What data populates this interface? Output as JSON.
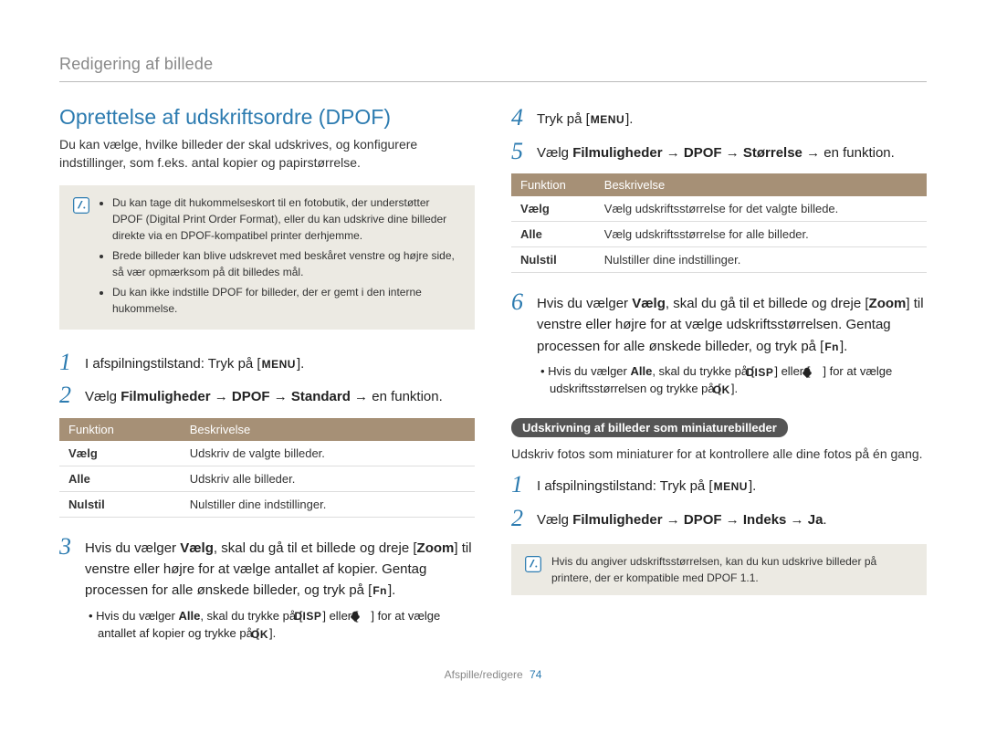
{
  "breadcrumb": "Redigering af billede",
  "left": {
    "heading": "Oprettelse af udskriftsordre (DPOF)",
    "intro": "Du kan vælge, hvilke billeder der skal udskrives, og konfigurere indstillinger, som f.eks. antal kopier og papirstørrelse.",
    "note_items": [
      "Du kan tage dit hukommelseskort til en fotobutik, der understøtter DPOF (Digital Print Order Format), eller du kan udskrive dine billeder direkte via en DPOF-kompatibel printer derhjemme.",
      "Brede billeder kan blive udskrevet med beskåret venstre og højre side, så vær opmærksom på dit billedes mål.",
      "Du kan ikke indstille DPOF for billeder, der er gemt i den interne hukommelse."
    ],
    "step1_a": "I afspilningstilstand: Tryk på [",
    "step1_b": "].",
    "step2_a": "Vælg ",
    "step2_b": " → en funktion.",
    "step2_path": "Filmuligheder → DPOF → Standard",
    "table_hdr_func": "Funktion",
    "table_hdr_desc": "Beskrivelse",
    "table_rows": [
      {
        "f": "Vælg",
        "d": "Udskriv de valgte billeder."
      },
      {
        "f": "Alle",
        "d": "Udskriv alle billeder."
      },
      {
        "f": "Nulstil",
        "d": "Nulstiller dine indstillinger."
      }
    ],
    "step3_a": "Hvis du vælger ",
    "step3_bold1": "Vælg",
    "step3_b": ", skal du gå til et billede og dreje [",
    "step3_bold2": "Zoom",
    "step3_c": "] til venstre eller højre for at vælge antallet af kopier. Gentag processen for alle ønskede billeder, og tryk på [",
    "step3_d": "].",
    "step3_sub_a": "• Hvis du vælger ",
    "step3_sub_bold": "Alle",
    "step3_sub_b": ", skal du trykke på [",
    "step3_sub_c": "] eller [",
    "step3_sub_d": "] for at vælge antallet af kopier og trykke på [",
    "step3_sub_e": "]."
  },
  "right": {
    "step4_a": "Tryk på [",
    "step4_b": "].",
    "step5_a": "Vælg ",
    "step5_path": "Filmuligheder → DPOF → Størrelse",
    "step5_b": " → en funktion.",
    "table_hdr_func": "Funktion",
    "table_hdr_desc": "Beskrivelse",
    "table_rows": [
      {
        "f": "Vælg",
        "d": "Vælg udskriftsstørrelse for det valgte billede."
      },
      {
        "f": "Alle",
        "d": "Vælg udskriftsstørrelse for alle billeder."
      },
      {
        "f": "Nulstil",
        "d": "Nulstiller dine indstillinger."
      }
    ],
    "step6_a": "Hvis du vælger ",
    "step6_bold1": "Vælg",
    "step6_b": ", skal du gå til et billede og dreje [",
    "step6_bold2": "Zoom",
    "step6_c": "] til venstre eller højre for at vælge udskriftsstørrelsen. Gentag processen for alle ønskede billeder, og tryk på [",
    "step6_d": "].",
    "step6_sub_a": "• Hvis du vælger ",
    "step6_sub_bold": "Alle",
    "step6_sub_b": ", skal du trykke på [",
    "step6_sub_c": "] eller [",
    "step6_sub_d": "] for at vælge udskriftsstørrelsen og trykke på [",
    "step6_sub_e": "].",
    "pill": "Udskrivning af billeder som miniaturebilleder",
    "pill_para": "Udskriv fotos som miniaturer for at kontrollere alle dine fotos på én gang.",
    "r_step1_a": "I afspilningstilstand: Tryk på [",
    "r_step1_b": "].",
    "r_step2_a": "Vælg ",
    "r_step2_path": "Filmuligheder → DPOF → Indeks → Ja",
    "r_step2_b": ".",
    "note2": "Hvis du angiver udskriftsstørrelsen, kan du kun udskrive billeder på printere, der er kompatible med DPOF 1.1."
  },
  "labels": {
    "menu": "MENU",
    "fn": "Fn",
    "disp": "DISP",
    "ok": "OK"
  },
  "footer": {
    "section": "Afspille/redigere",
    "page": "74"
  }
}
